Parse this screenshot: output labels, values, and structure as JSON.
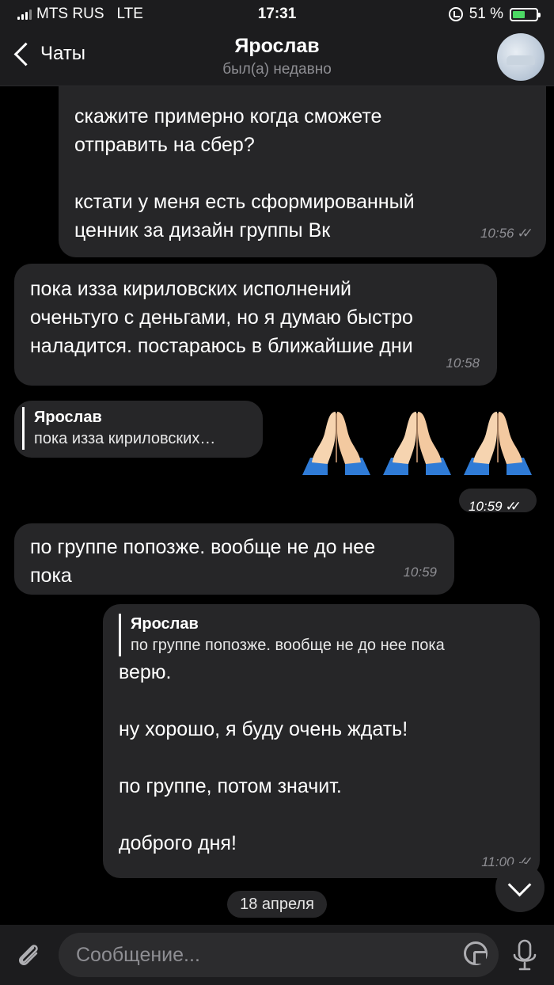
{
  "status_bar": {
    "carrier": "MTS RUS",
    "network": "LTE",
    "time": "17:31",
    "battery_percent": "51 %",
    "battery_level": 0.55,
    "battery_color": "#4cd964"
  },
  "nav": {
    "back_label": "Чаты",
    "title": "Ярослав",
    "subtitle": "был(а) недавно",
    "back_icon": "chevron-left-icon",
    "avatar_icon": "profile-photo"
  },
  "messages": [
    {
      "id": "m1",
      "direction": "outgoing",
      "text": "скажите примерно когда сможете\nотправить на сбер?\n\nкстати у меня есть сформированный\nценник за дизайн группы Вк",
      "time": "10:56",
      "read": true
    },
    {
      "id": "m2",
      "direction": "incoming",
      "text": "пока изза кириловских исполнений\nоченьтуго с деньгами, но я думаю быстро\nналадится. постараюсь в ближайшие дни",
      "time": "10:58"
    },
    {
      "id": "m3",
      "direction": "outgoing",
      "type": "emoji",
      "reply_name": "Ярослав",
      "reply_text": "пока изза кириловских…",
      "emoji": [
        "folded-hands-emoji",
        "folded-hands-emoji",
        "folded-hands-emoji"
      ],
      "time": "10:59",
      "read": true
    },
    {
      "id": "m4",
      "direction": "incoming",
      "text": "по группе попозже. вообще не до нее\nпока",
      "time": "10:59"
    },
    {
      "id": "m5",
      "direction": "outgoing",
      "reply_name": "Ярослав",
      "reply_text": "по группе попозже. вообще не до нее пока",
      "text": "верю.\n\nну хорошо, я буду очень ждать!\n\nпо группе, потом значит.\n\nдоброго дня!",
      "time": "11:00",
      "read": true
    }
  ],
  "date_separator": "18 апреля",
  "input": {
    "placeholder": "Сообщение..."
  },
  "colors": {
    "background": "#000000",
    "bubble": "#262628",
    "bar": "#1c1c1e",
    "meta_text": "#8e8e93"
  }
}
